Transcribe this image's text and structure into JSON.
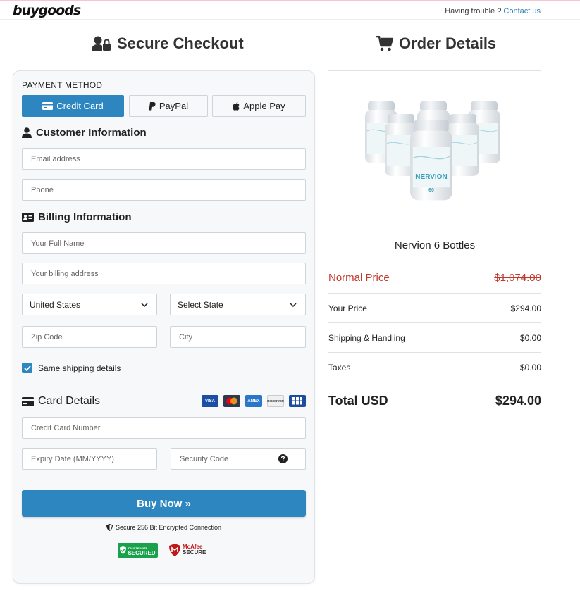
{
  "header": {
    "logo": "buygoods",
    "trouble_text": "Having trouble ?",
    "contact_label": "Contact us"
  },
  "checkout": {
    "title": "Secure Checkout",
    "payment_method_label": "PAYMENT METHOD",
    "payment_options": [
      {
        "label": "Credit Card",
        "active": true
      },
      {
        "label": "PayPal",
        "active": false
      },
      {
        "label": "Apple Pay",
        "active": false
      }
    ],
    "customer_heading": "Customer Information",
    "email_placeholder": "Email address",
    "phone_placeholder": "Phone",
    "billing_heading": "Billing Information",
    "name_placeholder": "Your Full Name",
    "address_placeholder": "Your billing address",
    "country_value": "United States",
    "state_value": "Select State",
    "zip_placeholder": "Zip Code",
    "city_placeholder": "City",
    "same_shipping_label": "Same shipping details",
    "same_shipping_checked": true,
    "card_heading": "Card Details",
    "card_brands": [
      "VISA",
      "Mastercard",
      "AMEX",
      "DISCOVER",
      "JCB"
    ],
    "card_number_placeholder": "Credit Card Number",
    "expiry_placeholder": "Expiry Date (MM/YYYY)",
    "cvv_placeholder": "Security Code",
    "buy_button": "Buy Now »",
    "secure_note": "Secure 256 Bit Encrypted Connection",
    "badge_trustedsite_top": "TRUSTEDSITE",
    "badge_trustedsite": "SECURED",
    "badge_mcafee_1": "McAfee",
    "badge_mcafee_2": "SECURE"
  },
  "order": {
    "title": "Order Details",
    "product_label": "NERVION",
    "product_count_label": "60",
    "product_name": "Nervion 6 Bottles",
    "normal_price_label": "Normal Price",
    "normal_price": "$1,074.00",
    "your_price_label": "Your Price",
    "your_price": "$294.00",
    "shipping_label": "Shipping & Handling",
    "shipping": "$0.00",
    "taxes_label": "Taxes",
    "taxes": "$0.00",
    "total_label": "Total USD",
    "total": "$294.00"
  },
  "colors": {
    "accent": "#2e86c1",
    "normal_price": "#c0392b",
    "secured_badge": "#19a24b"
  }
}
